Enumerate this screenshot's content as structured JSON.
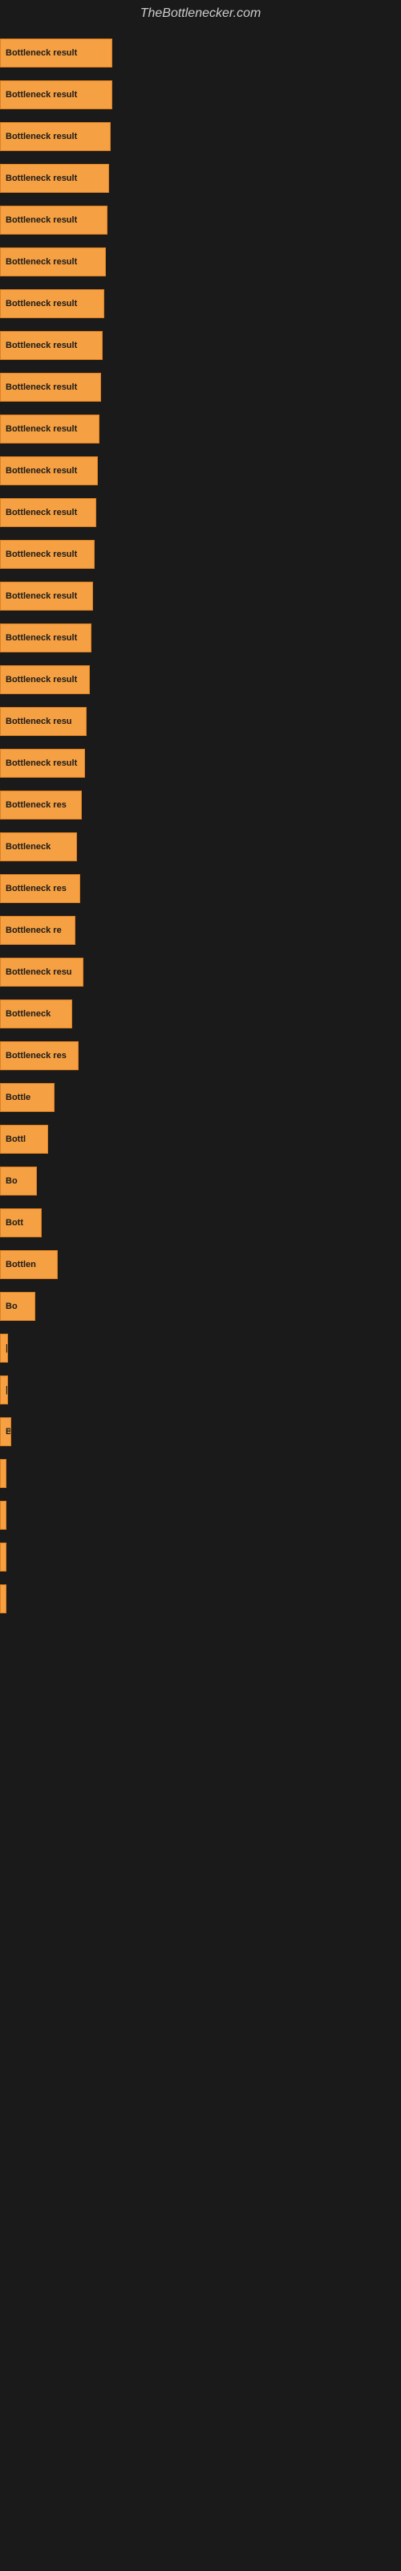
{
  "site": {
    "title": "TheBottlenecker.com"
  },
  "bars": [
    {
      "label": "Bottleneck result",
      "width": 140,
      "visible_text": "Bottleneck result"
    },
    {
      "label": "Bottleneck result",
      "width": 140,
      "visible_text": "Bottleneck result"
    },
    {
      "label": "Bottleneck result",
      "width": 138,
      "visible_text": "Bottleneck result"
    },
    {
      "label": "Bottleneck result",
      "width": 136,
      "visible_text": "Bottleneck result"
    },
    {
      "label": "Bottleneck result",
      "width": 134,
      "visible_text": "Bottleneck result"
    },
    {
      "label": "Bottleneck result",
      "width": 132,
      "visible_text": "Bottleneck result"
    },
    {
      "label": "Bottleneck result",
      "width": 130,
      "visible_text": "Bottleneck result"
    },
    {
      "label": "Bottleneck result",
      "width": 128,
      "visible_text": "Bottleneck result"
    },
    {
      "label": "Bottleneck result",
      "width": 126,
      "visible_text": "Bottleneck result"
    },
    {
      "label": "Bottleneck result",
      "width": 124,
      "visible_text": "Bottleneck result"
    },
    {
      "label": "Bottleneck result",
      "width": 122,
      "visible_text": "Bottleneck result"
    },
    {
      "label": "Bottleneck result",
      "width": 120,
      "visible_text": "Bottleneck result"
    },
    {
      "label": "Bottleneck result",
      "width": 118,
      "visible_text": "Bottleneck result"
    },
    {
      "label": "Bottleneck result",
      "width": 116,
      "visible_text": "Bottleneck result"
    },
    {
      "label": "Bottleneck result",
      "width": 114,
      "visible_text": "Bottleneck result"
    },
    {
      "label": "Bottleneck result",
      "width": 112,
      "visible_text": "Bottleneck result"
    },
    {
      "label": "Bottleneck result",
      "width": 108,
      "visible_text": "Bottleneck resu"
    },
    {
      "label": "Bottleneck result",
      "width": 106,
      "visible_text": "Bottleneck result"
    },
    {
      "label": "Bottleneck result",
      "width": 102,
      "visible_text": "Bottleneck res"
    },
    {
      "label": "Bottleneck",
      "width": 96,
      "visible_text": "Bottleneck"
    },
    {
      "label": "Bottleneck result",
      "width": 100,
      "visible_text": "Bottleneck res"
    },
    {
      "label": "Bottleneck result",
      "width": 94,
      "visible_text": "Bottleneck re"
    },
    {
      "label": "Bottleneck result",
      "width": 104,
      "visible_text": "Bottleneck resu"
    },
    {
      "label": "Bottleneck",
      "width": 90,
      "visible_text": "Bottleneck"
    },
    {
      "label": "Bottleneck result",
      "width": 98,
      "visible_text": "Bottleneck res"
    },
    {
      "label": "Bottleneck result",
      "width": 68,
      "visible_text": "Bottle"
    },
    {
      "label": "Bottleneck result",
      "width": 60,
      "visible_text": "Bottl"
    },
    {
      "label": "Bottleneck result",
      "width": 46,
      "visible_text": "Bo"
    },
    {
      "label": "Bottleneck result",
      "width": 52,
      "visible_text": "Bott"
    },
    {
      "label": "Bottleneck result",
      "width": 72,
      "visible_text": "Bottlen"
    },
    {
      "label": "Bottleneck result",
      "width": 44,
      "visible_text": "Bo"
    },
    {
      "label": "|",
      "width": 10,
      "visible_text": "|"
    },
    {
      "label": "|",
      "width": 10,
      "visible_text": "|"
    },
    {
      "label": "B",
      "width": 14,
      "visible_text": "B"
    },
    {
      "label": "",
      "width": 8,
      "visible_text": ""
    },
    {
      "label": "",
      "width": 6,
      "visible_text": ""
    },
    {
      "label": "",
      "width": 4,
      "visible_text": ""
    },
    {
      "label": "",
      "width": 4,
      "visible_text": ""
    }
  ]
}
